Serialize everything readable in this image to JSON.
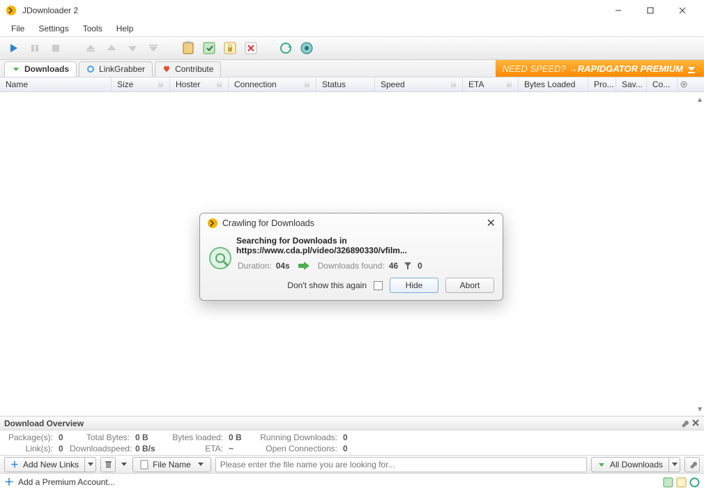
{
  "title": "JDownloader 2",
  "menus": [
    "File",
    "Settings",
    "Tools",
    "Help"
  ],
  "tabs": {
    "downloads": "Downloads",
    "linkgrabber": "LinkGrabber",
    "contribute": "Contribute"
  },
  "promo": {
    "lead": "NEED SPEED?",
    "rest": "→RAPIDGATOR PREMIUM"
  },
  "cols": {
    "name": "Name",
    "size": "Size",
    "hoster": "Hoster",
    "connection": "Connection",
    "status": "Status",
    "speed": "Speed",
    "eta": "ETA",
    "bytes": "Bytes Loaded",
    "pro": "Pro...",
    "sav": "Sav...",
    "co": "Co..."
  },
  "overview": {
    "header": "Download Overview",
    "labels": {
      "packages": "Package(s):",
      "totalbytes": "Total Bytes:",
      "bytesloaded": "Bytes loaded:",
      "running": "Running Downloads:",
      "links": "Link(s):",
      "dlspeed": "Downloadspeed:",
      "eta": "ETA:",
      "openconn": "Open Connections:"
    },
    "values": {
      "packages": "0",
      "totalbytes": "0 B",
      "bytesloaded": "0 B",
      "running": "0",
      "links": "0",
      "dlspeed": "0 B/s",
      "eta": "~",
      "openconn": "0"
    }
  },
  "addbar": {
    "addlinks": "Add New Links",
    "filename": "File Name",
    "placeholder": "Please enter the file name you are looking for...",
    "alldl": "All Downloads"
  },
  "premium": "Add a Premium Account...",
  "dialog": {
    "title": "Crawling for Downloads",
    "msg": "Searching for Downloads in https://www.cda.pl/video/326890330/vfilm...",
    "duration_lbl": "Duration:",
    "duration_val": "04s",
    "found_lbl": "Downloads found:",
    "found_val": "46",
    "filtered_val": "0",
    "dontshow": "Don't show this again",
    "hide": "Hide",
    "abort": "Abort"
  }
}
